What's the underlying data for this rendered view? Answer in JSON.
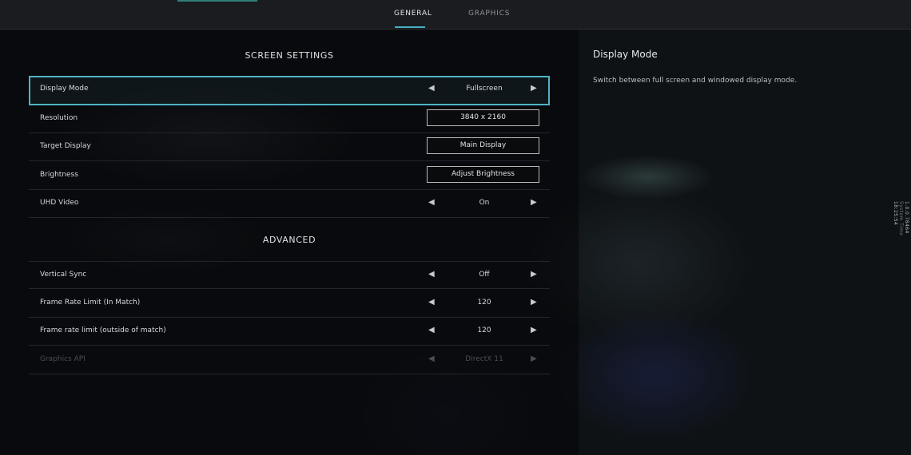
{
  "tabs": [
    {
      "label": "GENERAL",
      "active": true
    },
    {
      "label": "GRAPHICS",
      "active": false
    }
  ],
  "screen_settings": {
    "title": "SCREEN SETTINGS",
    "rows": [
      {
        "label": "Display Mode",
        "value": "Fullscreen",
        "control": "arrows",
        "selected": true
      },
      {
        "label": "Resolution",
        "value": "3840 x 2160",
        "control": "button"
      },
      {
        "label": "Target Display",
        "value": "Main Display",
        "control": "button"
      },
      {
        "label": "Brightness",
        "value": "Adjust Brightness",
        "control": "button"
      },
      {
        "label": "UHD Video",
        "value": "On",
        "control": "arrows"
      }
    ]
  },
  "advanced": {
    "title": "ADVANCED",
    "rows": [
      {
        "label": "Vertical Sync",
        "value": "Off",
        "control": "arrows"
      },
      {
        "label": "Frame Rate Limit (In Match)",
        "value": "120",
        "control": "arrows"
      },
      {
        "label": "Frame rate limit (outside of match)",
        "value": "120",
        "control": "arrows"
      },
      {
        "label": "Graphics API",
        "value": "DirectX 11",
        "control": "arrows",
        "disabled": true
      }
    ]
  },
  "help": {
    "title": "Display Mode",
    "description": "Switch between full screen and windowed display mode."
  },
  "side_info": {
    "version": "1.0.0.78464",
    "label": "System Time",
    "time": "18:25:54"
  },
  "icons": {
    "left_arrow": "◀",
    "right_arrow": "▶"
  },
  "colors": {
    "accent": "#4fb3c6",
    "disabled": "#4a4f54"
  }
}
